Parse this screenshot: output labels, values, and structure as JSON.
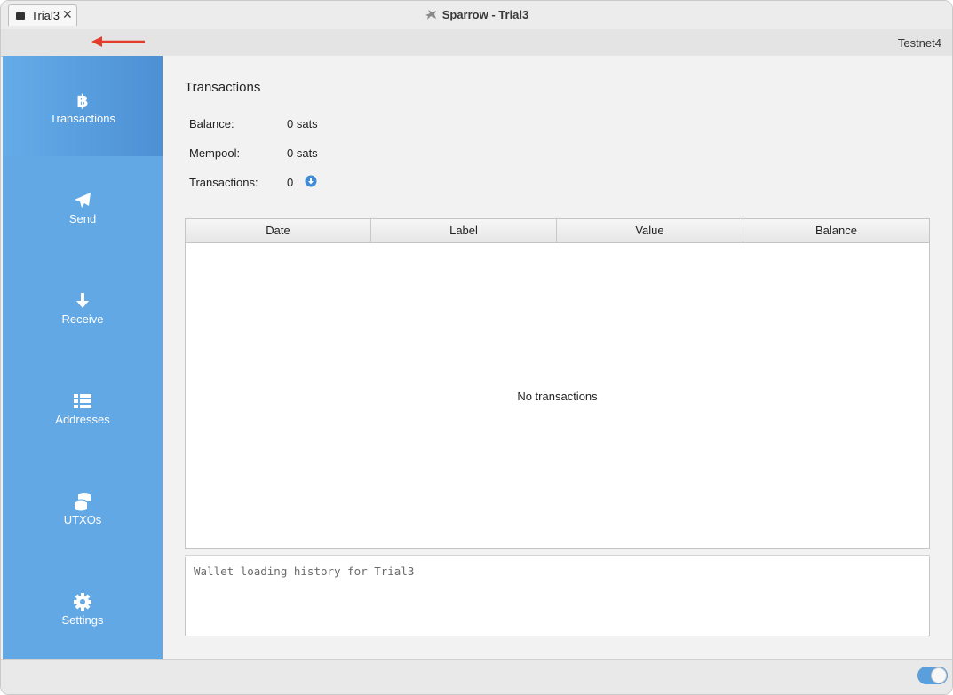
{
  "window": {
    "title": "Sparrow - Trial3"
  },
  "tabs": [
    {
      "label": "Trial3"
    }
  ],
  "network": "Testnet4",
  "sidebar": {
    "items": [
      {
        "label": "Transactions",
        "icon": "bitcoin-icon",
        "active": true
      },
      {
        "label": "Send",
        "icon": "paper-plane-icon"
      },
      {
        "label": "Receive",
        "icon": "arrow-down-icon"
      },
      {
        "label": "Addresses",
        "icon": "list-icon"
      },
      {
        "label": "UTXOs",
        "icon": "coins-icon"
      },
      {
        "label": "Settings",
        "icon": "gear-icon"
      }
    ]
  },
  "main": {
    "title": "Transactions",
    "stats": {
      "balance_label": "Balance:",
      "balance_value": "0 sats",
      "mempool_label": "Mempool:",
      "mempool_value": "0 sats",
      "transactions_label": "Transactions:",
      "transactions_value": "0"
    },
    "table": {
      "columns": [
        "Date",
        "Label",
        "Value",
        "Balance"
      ],
      "empty_message": "No transactions"
    },
    "log": "Wallet loading history for Trial3"
  },
  "colors": {
    "sidebar": "#62a8e5",
    "sidebar_active": "#4d90d4",
    "toggle": "#5a9fdc"
  }
}
